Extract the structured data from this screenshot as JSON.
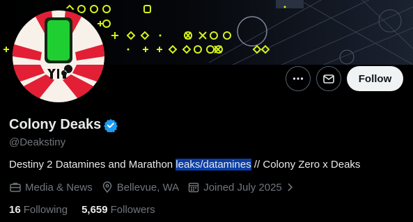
{
  "profile": {
    "display_name": "Colony Deaks",
    "verified": true,
    "handle": "@Deakstiny",
    "bio_before": "Destiny 2 Datamines and Marathon ",
    "bio_highlight": "leaks/datamines",
    "bio_after": " // Colony Zero x Deaks",
    "category": "Media & News",
    "location": "Bellevue, WA",
    "joined": "Joined July 2025"
  },
  "actions": {
    "follow_label": "Follow"
  },
  "stats": {
    "following_count": "16",
    "following_label": "Following",
    "followers_count": "5,659",
    "followers_label": "Followers"
  },
  "colors": {
    "accent_verified": "#1d9bf0",
    "follow_bg": "#eff3f4",
    "muted_text": "#71767b",
    "banner_glyph": "#d7f21a",
    "avatar_bg": "#f7f1ea",
    "avatar_red": "#e21f34",
    "avatar_green": "#1fcf31"
  },
  "icons": {
    "more": "more-horizontal-icon",
    "message": "mail-icon",
    "verified": "verified-badge-icon",
    "category": "briefcase-icon",
    "location": "location-pin-icon",
    "joined": "calendar-icon",
    "chevron": "chevron-right-icon"
  }
}
